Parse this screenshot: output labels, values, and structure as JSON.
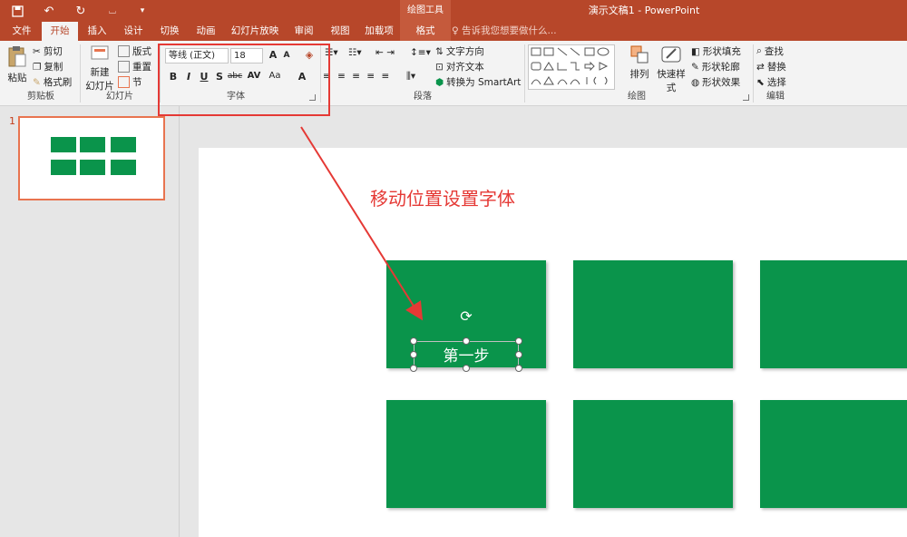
{
  "titlebar": {
    "context_group": "绘图工具",
    "title": "演示文稿1 - PowerPoint"
  },
  "tabs": [
    "文件",
    "开始",
    "插入",
    "设计",
    "切换",
    "动画",
    "幻灯片放映",
    "审阅",
    "视图",
    "加载项",
    "格式"
  ],
  "active_tab": "开始",
  "tellme": "告诉我您想要做什么...",
  "ribbon": {
    "clipboard": {
      "label": "剪贴板",
      "paste": "粘贴",
      "cut": "剪切",
      "copy": "复制",
      "format_painter": "格式刷"
    },
    "slides": {
      "label": "幻灯片",
      "new_slide_1": "新建",
      "new_slide_2": "幻灯片",
      "layout": "版式",
      "reset": "重置",
      "section": "节"
    },
    "font": {
      "label": "字体",
      "font_name": "等线 (正文)",
      "font_size": "18",
      "bold": "B",
      "italic": "I",
      "underline": "U",
      "shadow": "S",
      "strike": "abc",
      "spacing": "AV",
      "case": "Aa",
      "color": "A",
      "grow": "A",
      "shrink": "A"
    },
    "paragraph": {
      "label": "段落",
      "text_direction": "文字方向",
      "align_text": "对齐文本",
      "smartart": "转换为 SmartArt"
    },
    "drawing": {
      "label": "绘图",
      "arrange": "排列",
      "quick_styles": "快速样式",
      "fill": "形状填充",
      "outline": "形状轮廓",
      "effects": "形状效果"
    },
    "editing": {
      "label": "编辑",
      "find": "查找",
      "replace": "替换",
      "select": "选择"
    }
  },
  "thumbs": {
    "slide_number": "1"
  },
  "slide": {
    "annotation": "移动位置设置字体",
    "selected_text": "第一步"
  },
  "colors": {
    "ribbon_red": "#b7472a",
    "card_green": "#0a944b",
    "annotation_red": "#e53935"
  }
}
